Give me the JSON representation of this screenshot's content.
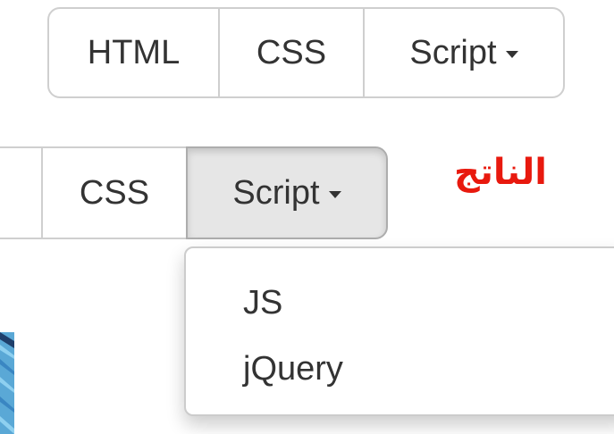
{
  "top_group": {
    "html_label": "HTML",
    "css_label": "CSS",
    "script_label": "Script"
  },
  "result_label": "الناتج",
  "bottom_group": {
    "css_label": "CSS",
    "script_label": "Script"
  },
  "dropdown": {
    "items": [
      {
        "label": "JS"
      },
      {
        "label": "jQuery"
      }
    ]
  },
  "colors": {
    "border": "#cfcfcf",
    "active_bg": "#e6e6e6",
    "result_label": "#e8190e",
    "text": "#333333"
  },
  "icons": {
    "caret": "chevron-down-icon"
  }
}
